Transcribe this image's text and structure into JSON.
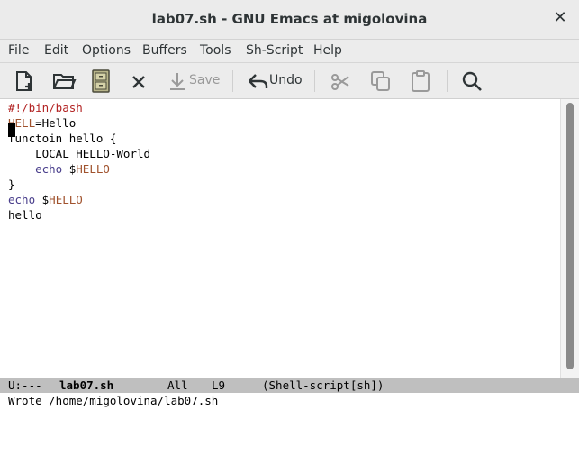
{
  "window": {
    "title": "lab07.sh - GNU Emacs at migolovina",
    "close_glyph": "✕"
  },
  "menubar": {
    "items": [
      "File",
      "Edit",
      "Options",
      "Buffers",
      "Tools",
      "Sh-Script",
      "Help"
    ]
  },
  "toolbar": {
    "icons": [
      "new-file-icon",
      "open-folder-icon",
      "save-buffer-icon",
      "close-icon",
      "save-icon",
      "undo-icon",
      "cut-icon",
      "copy-icon",
      "paste-icon",
      "search-icon"
    ],
    "save_label": "Save",
    "undo_label": "Undo"
  },
  "editor": {
    "lines": [
      {
        "parts": [
          {
            "text": "#!/bin/bash",
            "style": "comment"
          }
        ]
      },
      {
        "parts": [
          {
            "text": "HELL",
            "style": "var"
          },
          {
            "text": "=Hello",
            "style": "plain"
          }
        ]
      },
      {
        "parts": [
          {
            "text": "functoin hello {",
            "style": "plain"
          }
        ]
      },
      {
        "parts": [
          {
            "text": "    LOCAL HELLO-World",
            "style": "plain"
          }
        ]
      },
      {
        "parts": [
          {
            "text": "    ",
            "style": "plain"
          },
          {
            "text": "echo",
            "style": "builtin"
          },
          {
            "text": " $",
            "style": "plain"
          },
          {
            "text": "HELLO",
            "style": "var"
          }
        ]
      },
      {
        "parts": [
          {
            "text": "}",
            "style": "plain"
          }
        ]
      },
      {
        "parts": [
          {
            "text": "echo",
            "style": "builtin"
          },
          {
            "text": " $",
            "style": "plain"
          },
          {
            "text": "HELLO",
            "style": "var"
          }
        ]
      },
      {
        "parts": [
          {
            "text": "hello",
            "style": "plain"
          }
        ]
      }
    ],
    "colors": {
      "comment": "#b22222",
      "var": "#a0522d",
      "builtin": "#483d8b"
    }
  },
  "modeline": {
    "status": "U:---",
    "buffer": "lab07.sh",
    "position": "All",
    "line": "L9",
    "mode": "(Shell-script[sh])"
  },
  "minibuffer": {
    "message": "Wrote /home/migolovina/lab07.sh"
  }
}
